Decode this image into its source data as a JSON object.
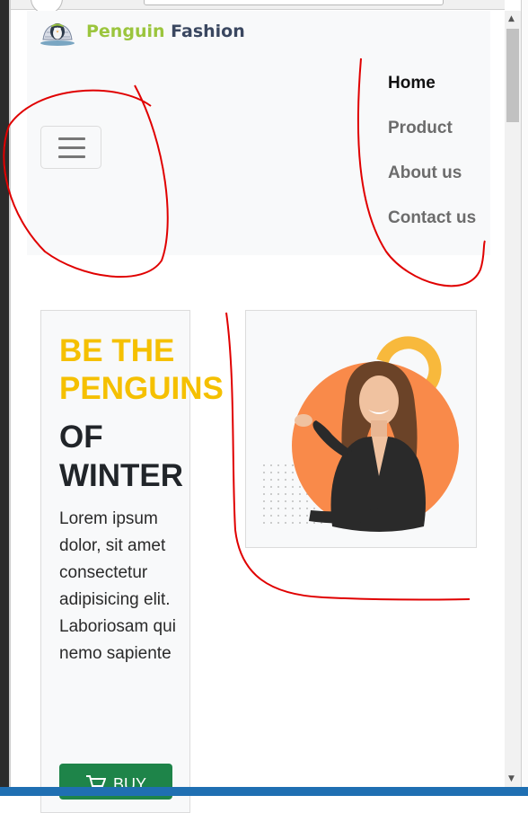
{
  "navbar": {
    "brand_part1": "Penguin",
    "brand_part2": "Fashion",
    "links": [
      {
        "label": "Home",
        "active": true
      },
      {
        "label": "Product",
        "active": false
      },
      {
        "label": "About us",
        "active": false
      },
      {
        "label": "Contact us",
        "active": false
      }
    ]
  },
  "hero": {
    "headline_yellow_1": "BE THE",
    "headline_yellow_2": "PENGUINS",
    "headline_dark_1": "OF",
    "headline_dark_2": "WINTER",
    "paragraph": "Lorem ipsum dolor, sit amet consectetur adipisicing elit. Laboriosam qui nemo sapiente",
    "button_label": "BUY"
  },
  "colors": {
    "brand_green": "#9bc53d",
    "brand_navy": "#3a4760",
    "headline_yellow": "#f5c000",
    "button_green": "#1e8449",
    "annotation_red": "#e00000"
  }
}
